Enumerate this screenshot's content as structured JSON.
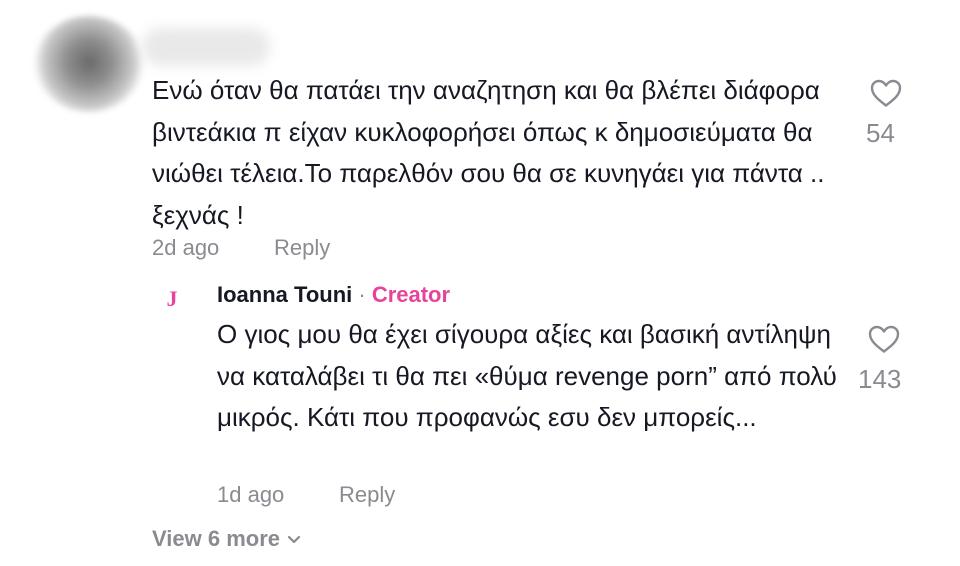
{
  "comment": {
    "text": "Ενώ όταν θα πατάει την αναζητηση και θα βλέπει διάφορα βιντεάκια π είχαν κυκλοφορήσει όπως κ δημοσιεύματα θα νιώθει τέλεια.Το παρελθόν σου θα σε κυνηγάει για πάντα .. ξεχνάς !",
    "time": "2d ago",
    "reply_label": "Reply",
    "likes": "54"
  },
  "reply": {
    "avatar_letter": "J",
    "author": "Ioanna Touni",
    "separator": " · ",
    "badge": "Creator",
    "text": "Ο γιος μου θα έχει σίγουρα αξίες και βασική αντίληψη να καταλάβει τι θα πει «θύμα revenge porn” από πολύ μικρός. Κάτι που προφανώς εσυ δεν μπορείς...",
    "time": "1d ago",
    "reply_label": "Reply",
    "likes": "143"
  },
  "view_more": "View 6 more",
  "colors": {
    "text": "#161823",
    "muted": "#8a8b91",
    "creator": "#e8439a"
  },
  "icons": {
    "like": "heart-outline-icon",
    "expand": "chevron-down-icon"
  }
}
